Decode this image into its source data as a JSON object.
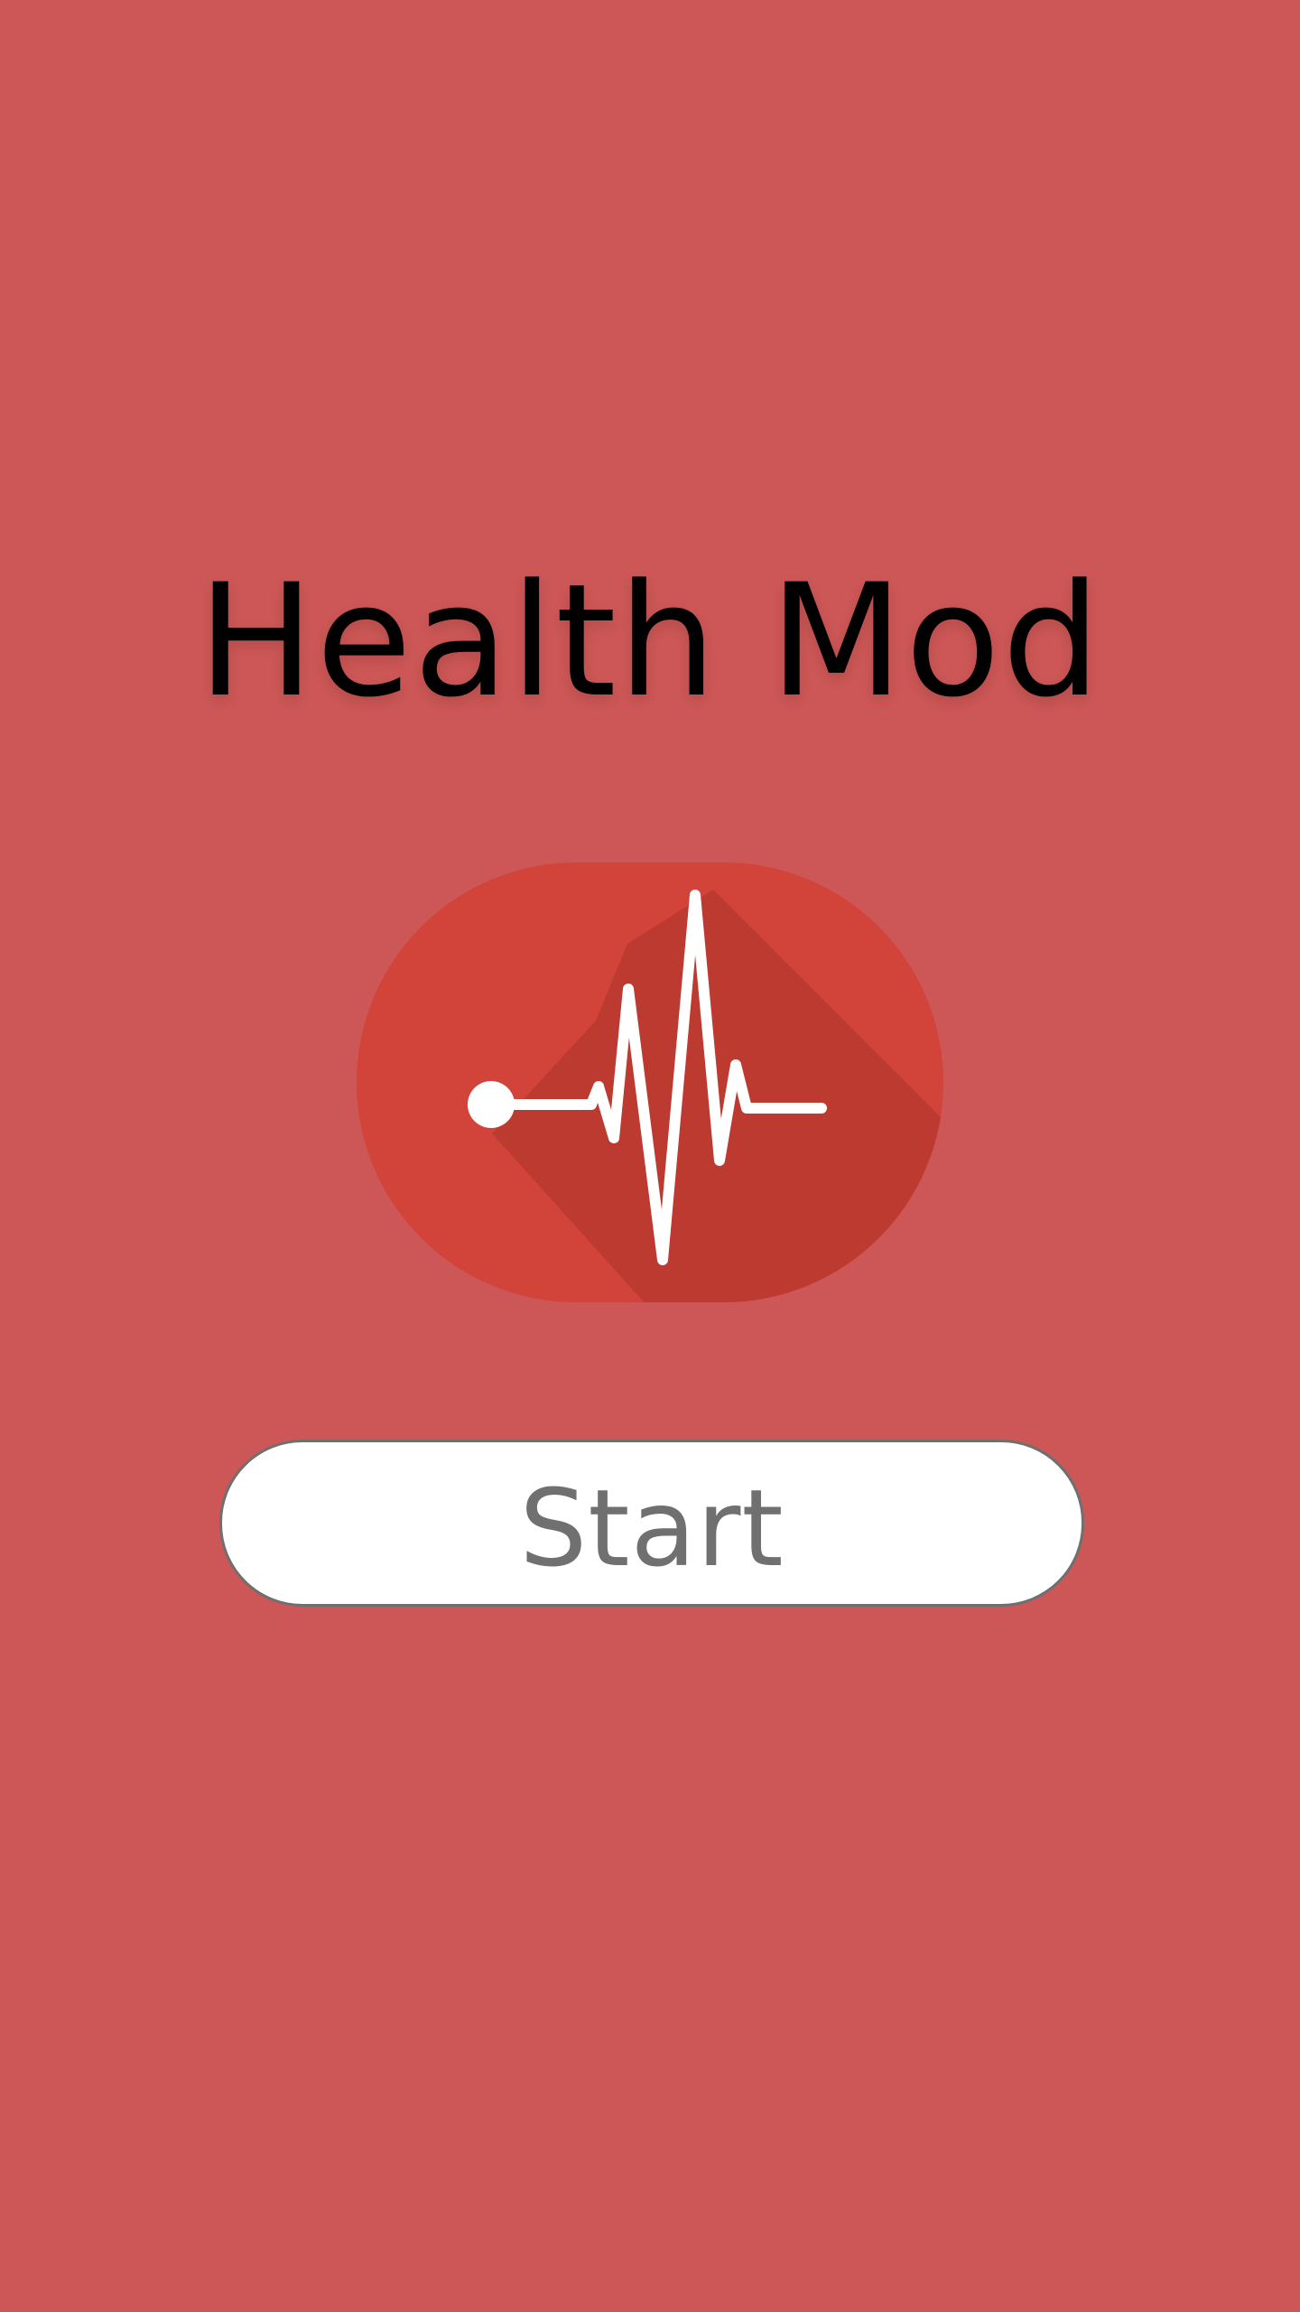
{
  "app": {
    "title": "Health Mod"
  },
  "logo": {
    "icon": "heartbeat-icon",
    "badge_color": "#d2443a",
    "shadow_color": "#bd3a31",
    "line_color": "#ffffff"
  },
  "start_button": {
    "label": "Start"
  },
  "colors": {
    "background": "#cc5756",
    "button_background": "#ffffff",
    "button_border": "#6f6f6f",
    "button_text": "#707070",
    "title_text": "#000000"
  }
}
